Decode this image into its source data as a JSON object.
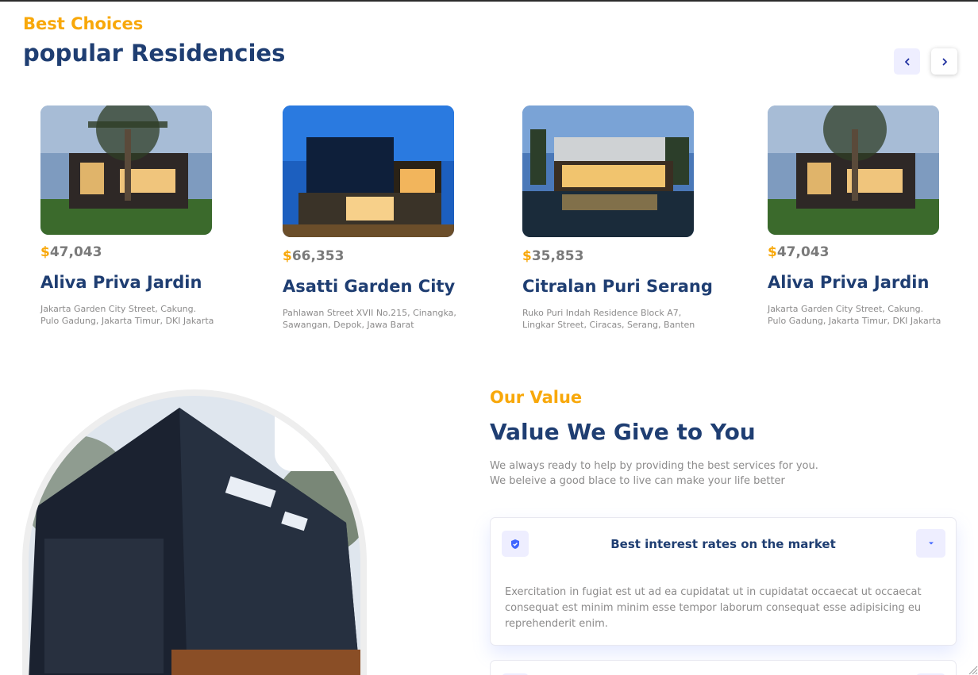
{
  "residencies": {
    "eyebrow": "Best Choices",
    "title": "popular Residencies",
    "nav": {
      "prev_icon": "chevron-left-icon",
      "next_icon": "chevron-right-icon"
    },
    "cards": [
      {
        "currency": "$",
        "price": "47,043",
        "name": "Aliva Priva Jardin",
        "address": "Jakarta Garden City Street, Cakung. Pulo Gadung, Jakarta Timur, DKI Jakarta"
      },
      {
        "currency": "$",
        "price": "66,353",
        "name": "Asatti Garden City",
        "address": "Pahlawan Street XVII No.215, Cinangka, Sawangan, Depok, Jawa Barat"
      },
      {
        "currency": "$",
        "price": "35,853",
        "name": "Citralan Puri Serang",
        "address": "Ruko Puri Indah Residence Block A7, Lingkar Street, Ciracas, Serang, Banten"
      },
      {
        "currency": "$",
        "price": "47,043",
        "name": "Aliva Priva Jardin",
        "address": "Jakarta Garden City Street, Cakung. Pulo Gadung, Jakarta Timur, DKI Jakarta"
      }
    ]
  },
  "value": {
    "eyebrow": "Our Value",
    "title": "Value We Give to You",
    "description_line1": "We always ready to help by providing the best services for you.",
    "description_line2": "We beleive a good blace to live can make your life better",
    "accordion": [
      {
        "icon": "shield-check-icon",
        "title": "Best interest rates on the market",
        "body": "Exercitation in fugiat est ut ad ea cupidatat ut in cupidatat occaecat ut occaecat consequat est minim minim esse tempor laborum consequat esse adipisicing eu reprehenderit enim.",
        "expanded": true,
        "toggle_icon": "caret-down-icon"
      }
    ]
  },
  "colors": {
    "accent": "#f8a80a",
    "primary": "#1f3e72",
    "muted": "#8c8b8b",
    "icon_bg": "#eeeeff",
    "icon_blue": "#4066ff"
  }
}
